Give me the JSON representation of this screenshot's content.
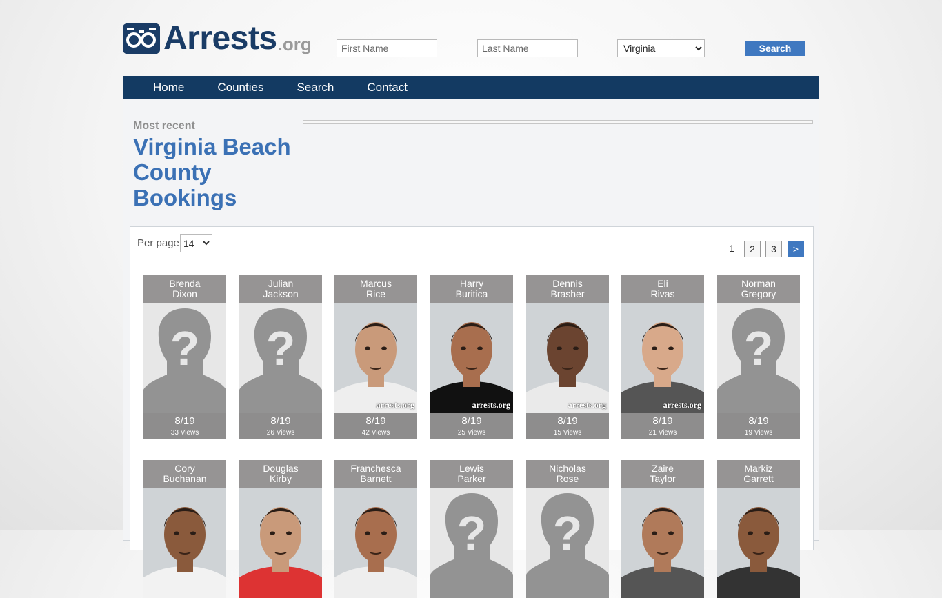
{
  "header": {
    "logo_text": "Arrests",
    "logo_suffix": ".org",
    "first_name_placeholder": "First Name",
    "last_name_placeholder": "Last Name",
    "state_selected": "Virginia",
    "search_label": "Search"
  },
  "nav": {
    "items": [
      {
        "label": "Home"
      },
      {
        "label": "Counties"
      },
      {
        "label": "Search"
      },
      {
        "label": "Contact"
      }
    ]
  },
  "page": {
    "kicker": "Most recent",
    "title": "Virginia Beach County Bookings"
  },
  "listing": {
    "per_page_label": "Per page",
    "per_page_value": "14",
    "pagination": [
      "1",
      "2",
      "3",
      ">"
    ]
  },
  "colors": {
    "brand_navy": "#133a62",
    "accent_blue": "#3f78c0",
    "title_blue": "#3b71b5"
  },
  "bookings": [
    {
      "first": "Brenda",
      "last": "Dixon",
      "date": "8/19",
      "views": "33 Views",
      "photo": "placeholder-silhouette"
    },
    {
      "first": "Julian",
      "last": "Jackson",
      "date": "8/19",
      "views": "26 Views",
      "photo": "placeholder-silhouette"
    },
    {
      "first": "Marcus",
      "last": "Rice",
      "date": "8/19",
      "views": "42 Views",
      "photo": "mugshot",
      "watermark": "arrests.org"
    },
    {
      "first": "Harry",
      "last": "Buritica",
      "date": "8/19",
      "views": "25 Views",
      "photo": "mugshot",
      "watermark": "arrests.org"
    },
    {
      "first": "Dennis",
      "last": "Brasher",
      "date": "8/19",
      "views": "15 Views",
      "photo": "mugshot",
      "watermark": "arrests.org"
    },
    {
      "first": "Eli",
      "last": "Rivas",
      "date": "8/19",
      "views": "21 Views",
      "photo": "mugshot",
      "watermark": "arrests.org"
    },
    {
      "first": "Norman",
      "last": "Gregory",
      "date": "8/19",
      "views": "19 Views",
      "photo": "placeholder-silhouette"
    },
    {
      "first": "Cory",
      "last": "Buchanan",
      "photo": "mugshot"
    },
    {
      "first": "Douglas",
      "last": "Kirby",
      "photo": "mugshot"
    },
    {
      "first": "Franchesca",
      "last": "Barnett",
      "photo": "mugshot"
    },
    {
      "first": "Lewis",
      "last": "Parker",
      "photo": "placeholder-silhouette"
    },
    {
      "first": "Nicholas",
      "last": "Rose",
      "photo": "placeholder-silhouette"
    },
    {
      "first": "Zaire",
      "last": "Taylor",
      "photo": "mugshot"
    },
    {
      "first": "Markiz",
      "last": "Garrett",
      "photo": "mugshot"
    }
  ]
}
